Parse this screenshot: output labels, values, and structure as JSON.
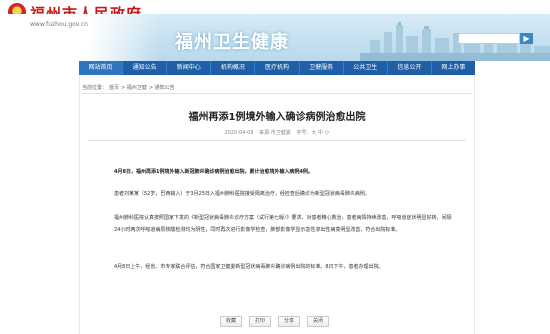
{
  "header": {
    "gov_name": "福州市人民政府",
    "gov_url": "www.fuzhou.gov.cn",
    "banner_title": "福州卫生健康",
    "search_button": "▶"
  },
  "nav": [
    {
      "label": "网站首页",
      "active": true
    },
    {
      "label": "通知公告"
    },
    {
      "label": "新闻中心"
    },
    {
      "label": "机构概况"
    },
    {
      "label": "医疗机构"
    },
    {
      "label": "卫健服务"
    },
    {
      "label": "公共卫生"
    },
    {
      "label": "信息公开"
    },
    {
      "label": "网上办事"
    }
  ],
  "breadcrumb": [
    "当前位置：",
    "首页",
    "> 福州卫健",
    "> 通知公告"
  ],
  "article": {
    "title": "福州再添1例境外输入确诊病例治愈出院",
    "date": "2020-04-08",
    "source": "来源:市卫健委",
    "font_size": "字号：大  中  小",
    "lead": "4月8日，福州再添1例境外输入新冠肺炎确诊病例治愈出院，累计治愈境外输入病例4例。",
    "p1": "患者刘某某（52岁，巴西输入）于3月25日入福州肺科医院接受隔离治疗，经检查后确诊为新型冠状病毒肺炎病例。",
    "p2": "福州肺科医院认真按照国家下发的《新型冠状病毒肺炎诊疗方案（试行第七版）》要求，对患者精心救治，患者病情持续改善，呼吸道症状明显好转，间隔24小时两次呼吸道病原核酸检测均为阴性，同时再次进行影像学检查，肺部影像学显示急性渗出性病变明显改善，符合出院标准。",
    "p3": "4月8日上午，经省、市专家联合评估，符合国家卫健委新型冠状病毒肺炎确诊病例出院的标准。8日下午，患者办理出院。"
  },
  "buttons": {
    "favorite": "收藏",
    "print": "打印",
    "share": "分享",
    "close": "关闭"
  }
}
